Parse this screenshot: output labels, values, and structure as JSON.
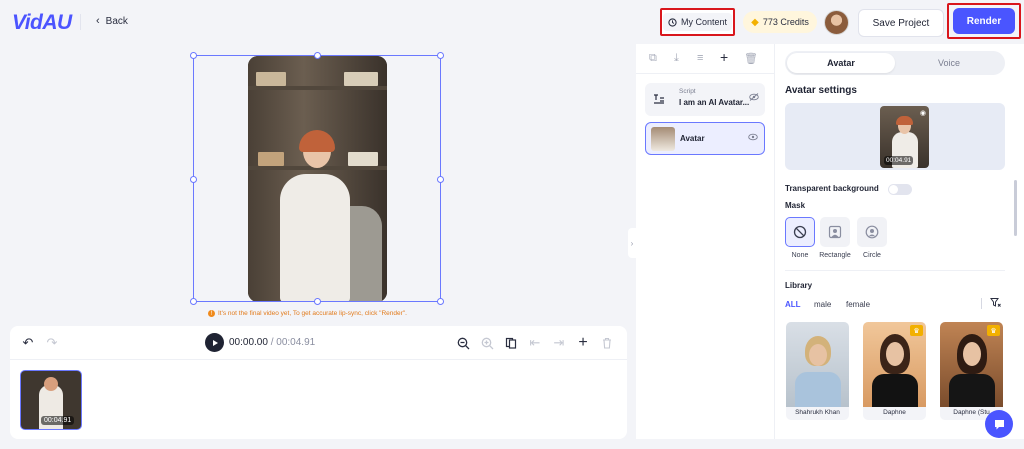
{
  "header": {
    "logo": "VidAU",
    "back_label": "Back",
    "my_content_label": "My Content",
    "credits_label": "773 Credits",
    "save_label": "Save Project",
    "render_label": "Render"
  },
  "canvas": {
    "hint": "It's not the final video yet, To get accurate lip-sync, click \"Render\"."
  },
  "timeline": {
    "current_time": "00:00.00",
    "separator": " / ",
    "total_time": "00:04.91",
    "clip_duration": "00:04.91"
  },
  "layers": {
    "items": [
      {
        "small_label": "Script",
        "name": "I am an AI Avatar...",
        "icon": "script-icon"
      },
      {
        "name": "Avatar",
        "icon": "avatar-thumb"
      }
    ]
  },
  "settings": {
    "tabs": [
      "Avatar",
      "Voice"
    ],
    "active_tab": "Avatar",
    "title": "Avatar settings",
    "preview_duration": "00:04.91",
    "transparent_bg_label": "Transparent background",
    "transparent_bg_on": false,
    "mask_title": "Mask",
    "mask_options": [
      "None",
      "Rectangle",
      "Circle"
    ],
    "mask_selected": "None",
    "library_title": "Library",
    "filters": [
      "ALL",
      "male",
      "female"
    ],
    "active_filter": "ALL",
    "library": [
      {
        "name": "Shahrukh Khan",
        "premium": false
      },
      {
        "name": "Daphne",
        "premium": true
      },
      {
        "name": "Daphne (Stu",
        "premium": true
      }
    ]
  },
  "colors": {
    "accent": "#4a55ff",
    "highlight_border": "#d9161c",
    "hint": "#e27b1c",
    "gem": "#f3b000"
  }
}
